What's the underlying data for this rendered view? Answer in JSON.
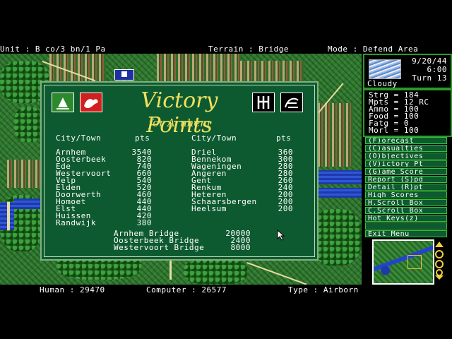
{
  "status": {
    "unit": "Unit : B co/3 bn/1 Pa",
    "terrain": "Terrain : Bridge",
    "mode": "Mode : Defend Area"
  },
  "panel": {
    "title": "Victory Points",
    "subtitle": "for Arnhem",
    "header_city": "City/Town",
    "header_pts": "pts",
    "left_cities": [
      {
        "name": "Arnhem",
        "pts": "3540"
      },
      {
        "name": "Oosterbeek",
        "pts": "820"
      },
      {
        "name": "Ede",
        "pts": "740"
      },
      {
        "name": "Westervoort",
        "pts": "660"
      },
      {
        "name": "Velp",
        "pts": "540"
      },
      {
        "name": "Elden",
        "pts": "520"
      },
      {
        "name": "Doorwerth",
        "pts": "460"
      },
      {
        "name": "Homoet",
        "pts": "440"
      },
      {
        "name": "Elst",
        "pts": "440"
      },
      {
        "name": "Huissen",
        "pts": "420"
      },
      {
        "name": "Randwijk",
        "pts": "380"
      }
    ],
    "right_cities": [
      {
        "name": "Driel",
        "pts": "360"
      },
      {
        "name": "Bennekom",
        "pts": "300"
      },
      {
        "name": "Wageningen",
        "pts": "280"
      },
      {
        "name": "Angeren",
        "pts": "280"
      },
      {
        "name": "Gent",
        "pts": "260"
      },
      {
        "name": "Renkum",
        "pts": "240"
      },
      {
        "name": "Heteren",
        "pts": "200"
      },
      {
        "name": "Schaarsbergen",
        "pts": "200"
      },
      {
        "name": "Heelsum",
        "pts": "200"
      }
    ],
    "bridges": [
      {
        "name": "Arnhem Bridge",
        "pts": "20000"
      },
      {
        "name": "Oosterbeek Bridge",
        "pts": "2400"
      },
      {
        "name": "Westervoort Bridge",
        "pts": "8000"
      }
    ]
  },
  "sidebar": {
    "date": "9/20/44",
    "time": "6:00",
    "turn": "Turn 13",
    "weather": "Cloudy",
    "stats": [
      {
        "label": "Strg",
        "value": "184"
      },
      {
        "label": "Mpts",
        "value": "12 RC"
      },
      {
        "label": "Ammo",
        "value": "100"
      },
      {
        "label": "Food",
        "value": "100"
      },
      {
        "label": "Fatg",
        "value": "0"
      },
      {
        "label": "Morl",
        "value": "100"
      }
    ],
    "menu": [
      "(F)orecast",
      "(C)asualties",
      "(O)bjectives",
      "(V)ictory Pt",
      "(G)ame Score",
      "Report (S)pd",
      "Detail (R)pt",
      "High Scores",
      "H.Scroll Box",
      "C.Scroll Box",
      "Hot Keys(z)",
      "",
      "Exit Menu"
    ]
  },
  "bottom": {
    "human": "Human : 29470",
    "computer": "Computer : 26577",
    "type": "Type : Airborn"
  },
  "colors": {
    "panel_bg": "#0e5a30",
    "title_yellow": "#f0e060",
    "menu_border": "#3ac03a"
  }
}
